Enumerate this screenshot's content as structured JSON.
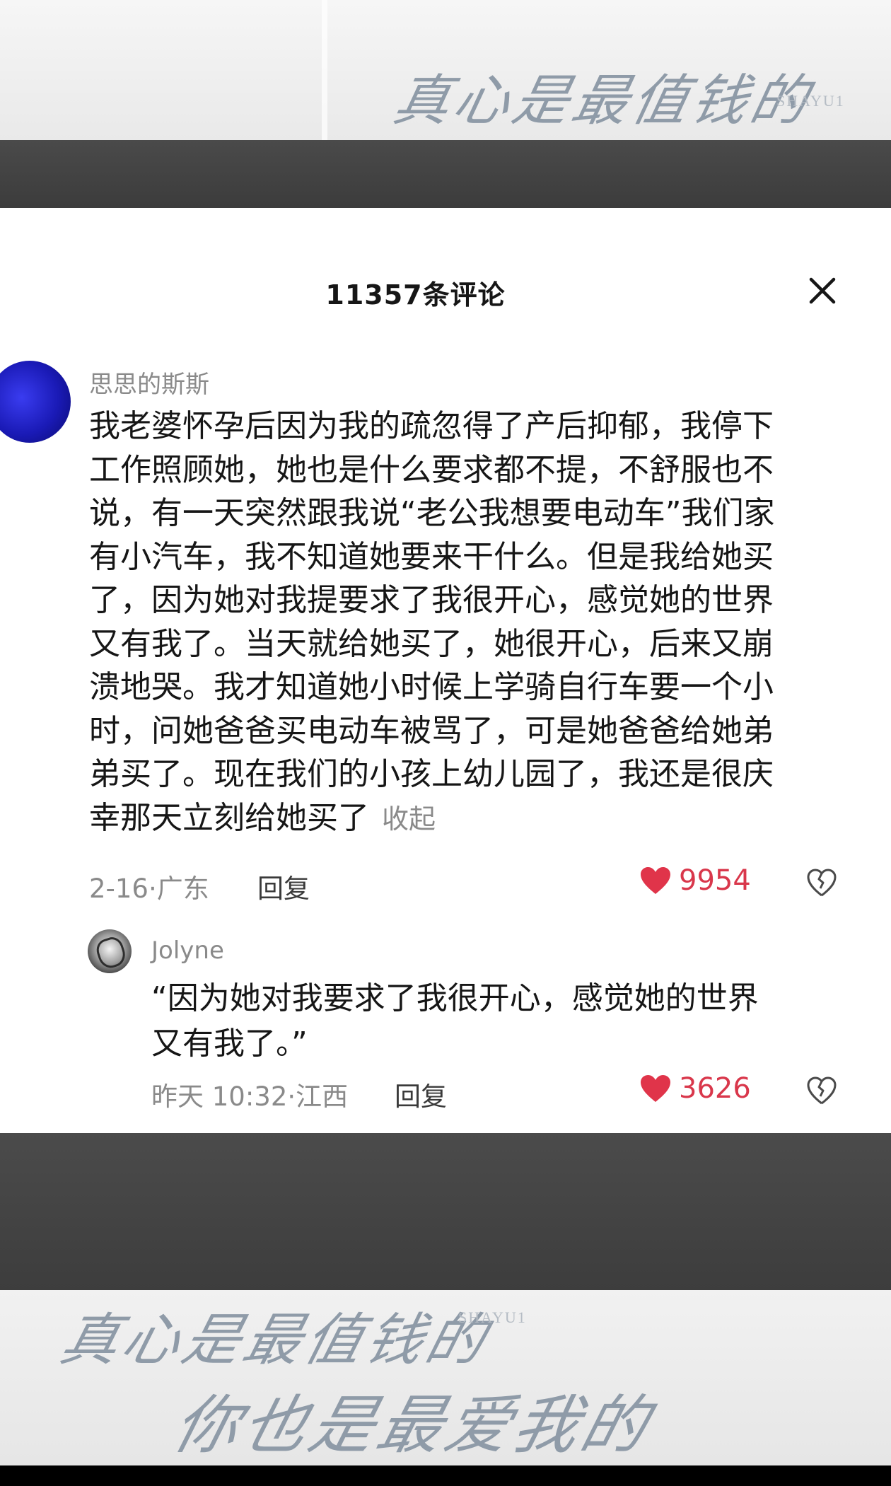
{
  "watermark": {
    "top_calligraphy": "真心是最值钱的",
    "brand": "SHAYU1",
    "bottom_calligraphy_1": "真心是最值钱的",
    "bottom_calligraphy_2": "你也是最爱我的"
  },
  "header": {
    "title": "11357条评论",
    "close_icon": "close-icon"
  },
  "comment": {
    "username": "思思的斯斯",
    "lines": [
      "我老婆怀孕后因为我的疏忽得了产后抑郁，我停下",
      "工作照顾她，她也是什么要求都不提，不舒服也不",
      "说，有一天突然跟我说“老公我想要电动车”我们家",
      "有小汽车，我不知道她要来干什么。但是我给她买",
      "了，因为她对我提要求了我很开心，感觉她的世界",
      "又有我了。当天就给她买了，她很开心，后来又崩",
      "溃地哭。我才知道她小时候上学骑自行车要一个小",
      "时，问她爸爸买电动车被骂了，可是她爸爸给她弟",
      "弟买了。现在我们的小孩上幼儿园了，我还是很庆",
      "幸那天立刻给她买了"
    ],
    "collapse_label": "收起",
    "meta": "2-16·广东",
    "reply_label": "回复",
    "like_count": "9954",
    "like_color": "#e0344a"
  },
  "reply": {
    "username": "Jolyne",
    "lines": [
      "“因为她对我要求了我很开心，感觉她的世界",
      "又有我了。”"
    ],
    "meta": "昨天 10:32·江西",
    "reply_label": "回复",
    "like_count": "3626"
  }
}
